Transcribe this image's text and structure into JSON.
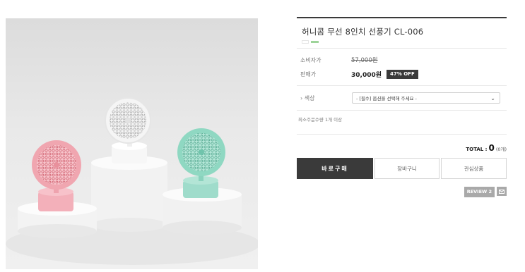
{
  "product": {
    "title": "허니콤 무선 8인치 선풍기 CL-006",
    "consumer_price_label": "소비자가",
    "consumer_price": "57,000원",
    "sale_price_label": "판매가",
    "sale_price": "30,000원",
    "discount_badge": "47% OFF",
    "option_label": "› 색상",
    "option_select_value": "- [필수] 옵션을 선택해 주세요 -",
    "min_order_note": "최소주문수량 1개 이상"
  },
  "total": {
    "label": "TOTAL :",
    "value": "0",
    "count": "(0개)"
  },
  "actions": {
    "buy_now": "바로구매",
    "cart": "장바구니",
    "wishlist": "관심상품",
    "review": "REVIEW 2"
  },
  "colors": {
    "dark": "#3a3a3a",
    "fan_pink": "#f0a6b0",
    "fan_white": "#f7f7f7",
    "fan_mint": "#8fd8c2",
    "review_gray": "#a9a9a9"
  }
}
